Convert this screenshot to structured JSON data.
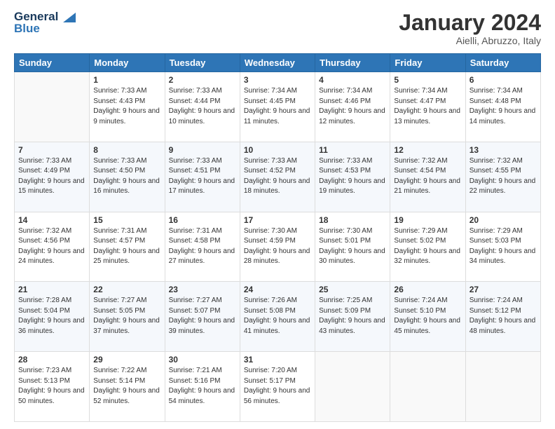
{
  "header": {
    "logo_line1": "General",
    "logo_line2": "Blue",
    "month": "January 2024",
    "location": "Aielli, Abruzzo, Italy"
  },
  "weekdays": [
    "Sunday",
    "Monday",
    "Tuesday",
    "Wednesday",
    "Thursday",
    "Friday",
    "Saturday"
  ],
  "weeks": [
    [
      {
        "day": "",
        "sunrise": "",
        "sunset": "",
        "daylight": ""
      },
      {
        "day": "1",
        "sunrise": "Sunrise: 7:33 AM",
        "sunset": "Sunset: 4:43 PM",
        "daylight": "Daylight: 9 hours and 9 minutes."
      },
      {
        "day": "2",
        "sunrise": "Sunrise: 7:33 AM",
        "sunset": "Sunset: 4:44 PM",
        "daylight": "Daylight: 9 hours and 10 minutes."
      },
      {
        "day": "3",
        "sunrise": "Sunrise: 7:34 AM",
        "sunset": "Sunset: 4:45 PM",
        "daylight": "Daylight: 9 hours and 11 minutes."
      },
      {
        "day": "4",
        "sunrise": "Sunrise: 7:34 AM",
        "sunset": "Sunset: 4:46 PM",
        "daylight": "Daylight: 9 hours and 12 minutes."
      },
      {
        "day": "5",
        "sunrise": "Sunrise: 7:34 AM",
        "sunset": "Sunset: 4:47 PM",
        "daylight": "Daylight: 9 hours and 13 minutes."
      },
      {
        "day": "6",
        "sunrise": "Sunrise: 7:34 AM",
        "sunset": "Sunset: 4:48 PM",
        "daylight": "Daylight: 9 hours and 14 minutes."
      }
    ],
    [
      {
        "day": "7",
        "sunrise": "Sunrise: 7:33 AM",
        "sunset": "Sunset: 4:49 PM",
        "daylight": "Daylight: 9 hours and 15 minutes."
      },
      {
        "day": "8",
        "sunrise": "Sunrise: 7:33 AM",
        "sunset": "Sunset: 4:50 PM",
        "daylight": "Daylight: 9 hours and 16 minutes."
      },
      {
        "day": "9",
        "sunrise": "Sunrise: 7:33 AM",
        "sunset": "Sunset: 4:51 PM",
        "daylight": "Daylight: 9 hours and 17 minutes."
      },
      {
        "day": "10",
        "sunrise": "Sunrise: 7:33 AM",
        "sunset": "Sunset: 4:52 PM",
        "daylight": "Daylight: 9 hours and 18 minutes."
      },
      {
        "day": "11",
        "sunrise": "Sunrise: 7:33 AM",
        "sunset": "Sunset: 4:53 PM",
        "daylight": "Daylight: 9 hours and 19 minutes."
      },
      {
        "day": "12",
        "sunrise": "Sunrise: 7:32 AM",
        "sunset": "Sunset: 4:54 PM",
        "daylight": "Daylight: 9 hours and 21 minutes."
      },
      {
        "day": "13",
        "sunrise": "Sunrise: 7:32 AM",
        "sunset": "Sunset: 4:55 PM",
        "daylight": "Daylight: 9 hours and 22 minutes."
      }
    ],
    [
      {
        "day": "14",
        "sunrise": "Sunrise: 7:32 AM",
        "sunset": "Sunset: 4:56 PM",
        "daylight": "Daylight: 9 hours and 24 minutes."
      },
      {
        "day": "15",
        "sunrise": "Sunrise: 7:31 AM",
        "sunset": "Sunset: 4:57 PM",
        "daylight": "Daylight: 9 hours and 25 minutes."
      },
      {
        "day": "16",
        "sunrise": "Sunrise: 7:31 AM",
        "sunset": "Sunset: 4:58 PM",
        "daylight": "Daylight: 9 hours and 27 minutes."
      },
      {
        "day": "17",
        "sunrise": "Sunrise: 7:30 AM",
        "sunset": "Sunset: 4:59 PM",
        "daylight": "Daylight: 9 hours and 28 minutes."
      },
      {
        "day": "18",
        "sunrise": "Sunrise: 7:30 AM",
        "sunset": "Sunset: 5:01 PM",
        "daylight": "Daylight: 9 hours and 30 minutes."
      },
      {
        "day": "19",
        "sunrise": "Sunrise: 7:29 AM",
        "sunset": "Sunset: 5:02 PM",
        "daylight": "Daylight: 9 hours and 32 minutes."
      },
      {
        "day": "20",
        "sunrise": "Sunrise: 7:29 AM",
        "sunset": "Sunset: 5:03 PM",
        "daylight": "Daylight: 9 hours and 34 minutes."
      }
    ],
    [
      {
        "day": "21",
        "sunrise": "Sunrise: 7:28 AM",
        "sunset": "Sunset: 5:04 PM",
        "daylight": "Daylight: 9 hours and 36 minutes."
      },
      {
        "day": "22",
        "sunrise": "Sunrise: 7:27 AM",
        "sunset": "Sunset: 5:05 PM",
        "daylight": "Daylight: 9 hours and 37 minutes."
      },
      {
        "day": "23",
        "sunrise": "Sunrise: 7:27 AM",
        "sunset": "Sunset: 5:07 PM",
        "daylight": "Daylight: 9 hours and 39 minutes."
      },
      {
        "day": "24",
        "sunrise": "Sunrise: 7:26 AM",
        "sunset": "Sunset: 5:08 PM",
        "daylight": "Daylight: 9 hours and 41 minutes."
      },
      {
        "day": "25",
        "sunrise": "Sunrise: 7:25 AM",
        "sunset": "Sunset: 5:09 PM",
        "daylight": "Daylight: 9 hours and 43 minutes."
      },
      {
        "day": "26",
        "sunrise": "Sunrise: 7:24 AM",
        "sunset": "Sunset: 5:10 PM",
        "daylight": "Daylight: 9 hours and 45 minutes."
      },
      {
        "day": "27",
        "sunrise": "Sunrise: 7:24 AM",
        "sunset": "Sunset: 5:12 PM",
        "daylight": "Daylight: 9 hours and 48 minutes."
      }
    ],
    [
      {
        "day": "28",
        "sunrise": "Sunrise: 7:23 AM",
        "sunset": "Sunset: 5:13 PM",
        "daylight": "Daylight: 9 hours and 50 minutes."
      },
      {
        "day": "29",
        "sunrise": "Sunrise: 7:22 AM",
        "sunset": "Sunset: 5:14 PM",
        "daylight": "Daylight: 9 hours and 52 minutes."
      },
      {
        "day": "30",
        "sunrise": "Sunrise: 7:21 AM",
        "sunset": "Sunset: 5:16 PM",
        "daylight": "Daylight: 9 hours and 54 minutes."
      },
      {
        "day": "31",
        "sunrise": "Sunrise: 7:20 AM",
        "sunset": "Sunset: 5:17 PM",
        "daylight": "Daylight: 9 hours and 56 minutes."
      },
      {
        "day": "",
        "sunrise": "",
        "sunset": "",
        "daylight": ""
      },
      {
        "day": "",
        "sunrise": "",
        "sunset": "",
        "daylight": ""
      },
      {
        "day": "",
        "sunrise": "",
        "sunset": "",
        "daylight": ""
      }
    ]
  ]
}
